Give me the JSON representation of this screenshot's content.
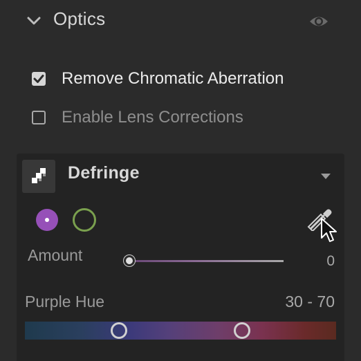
{
  "optics": {
    "title": "Optics",
    "remove_chromatic_aberration": {
      "label": "Remove Chromatic Aberration",
      "checked": true
    },
    "enable_lens_corrections": {
      "label": "Enable Lens Corrections",
      "checked": false
    }
  },
  "defringe": {
    "title": "Defringe",
    "swatches": {
      "purple": "#9650b8",
      "green": "#7aa04e"
    },
    "amount": {
      "label": "Amount",
      "value": "0"
    },
    "purple_hue": {
      "label": "Purple Hue",
      "value": "30 - 70",
      "low": 30,
      "high": 70
    }
  },
  "icons": {
    "collapse": "chevron-down-icon",
    "visibility": "eye-icon",
    "defringe": "defringe-icon",
    "panel_menu": "triangle-down-icon",
    "eyedropper": "eyedropper-icon",
    "cursor": "cursor-icon"
  }
}
